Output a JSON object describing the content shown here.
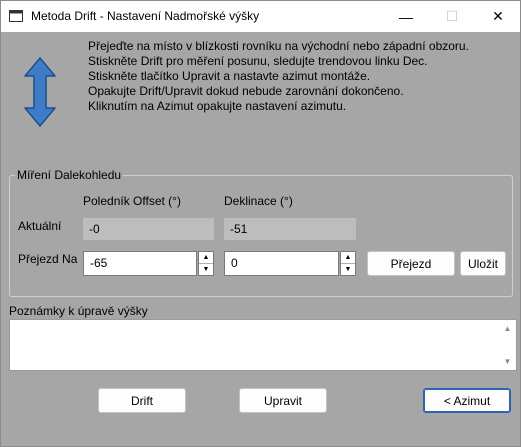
{
  "window": {
    "title": "Metoda Drift - Nastavení Nadmořské výšky",
    "minimize_icon": "minimize-icon",
    "maximize_icon": "maximize-icon",
    "close_icon": "close-icon",
    "min_glyph": "—",
    "max_glyph": "☐",
    "close_glyph": "✕"
  },
  "instructions": [
    "Přejeďte na místo v blízkosti rovníku na východní nebo západní obzoru.",
    "Stiskněte Drift pro měření posunu, sledujte trendovou linku Dec.",
    "Stiskněte tlačítko Upravit a nastavte azimut montáže.",
    "Opakujte Drift/Upravit dokud nebude zarovnání dokončeno.",
    "Kliknutím na Azimut opakujte nastavení azimutu."
  ],
  "pointing": {
    "group_title": "Míření Dalekohledu",
    "col_meridian": "Poledník Offset (°)",
    "col_declination": "Deklinace (°)",
    "row_current": "Aktuální",
    "row_slew_to": "Přejezd Na",
    "current_meridian": "-0",
    "current_declination": "-51",
    "slew_meridian": "-65",
    "slew_declination": "0",
    "slew_button": "Přejezd",
    "save_button": "Uložit"
  },
  "notes": {
    "label": "Poznámky k úpravě výšky",
    "value": ""
  },
  "footer": {
    "drift_button": "Drift",
    "adjust_button": "Upravit",
    "azimuth_button": "< Azimut"
  },
  "colors": {
    "background": "#a6a6a6",
    "arrow": "#3d7dc8",
    "default_button_border": "#2b63b9"
  }
}
